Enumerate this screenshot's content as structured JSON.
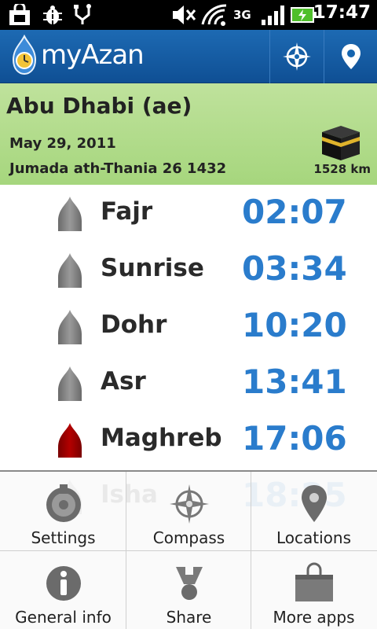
{
  "status_bar": {
    "time": "17:47",
    "network": "3G"
  },
  "action_bar": {
    "title": "myAzan"
  },
  "location": {
    "city": "Abu Dhabi (ae)",
    "gregorian_date": "May 29, 2011",
    "hijri_date": "Jumada ath-Thania 26 1432",
    "distance": "1528 km"
  },
  "prayers": [
    {
      "name": "Fajr",
      "time": "02:07",
      "state": "past"
    },
    {
      "name": "Sunrise",
      "time": "03:34",
      "state": "past"
    },
    {
      "name": "Dohr",
      "time": "10:20",
      "state": "past"
    },
    {
      "name": "Asr",
      "time": "13:41",
      "state": "past"
    },
    {
      "name": "Maghreb",
      "time": "17:06",
      "state": "current"
    },
    {
      "name": "Isha",
      "time": "18:25",
      "state": "upcoming"
    }
  ],
  "menu": [
    {
      "label": "Settings",
      "icon": "settings-icon"
    },
    {
      "label": "Compass",
      "icon": "compass-icon"
    },
    {
      "label": "Locations",
      "icon": "location-pin-icon"
    },
    {
      "label": "General info",
      "icon": "info-icon"
    },
    {
      "label": "Share",
      "icon": "share-icon"
    },
    {
      "label": "More apps",
      "icon": "shopping-bag-icon"
    }
  ],
  "colors": {
    "action_bar": "#1565b0",
    "header_green": "#b3dc8c",
    "time_blue": "#2a7ccc",
    "dome_past": "#9a9a9a",
    "dome_current": "#b30000"
  }
}
